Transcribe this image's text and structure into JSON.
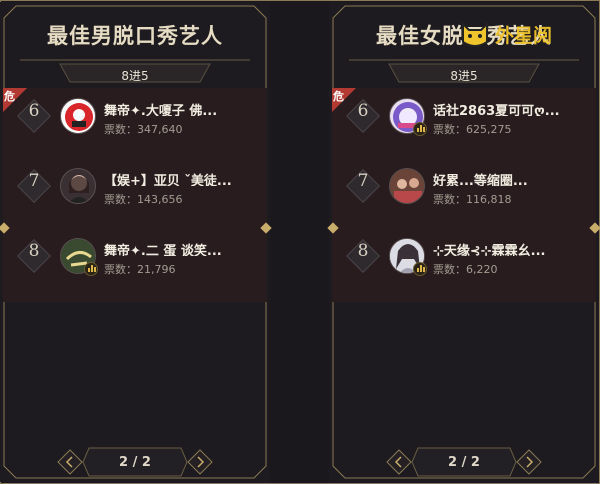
{
  "panels": [
    {
      "title": "最佳男脱口秀艺人",
      "round_label": "8进5",
      "danger_label": "危",
      "page_indicator": "2 / 2",
      "entries": [
        {
          "rank": "6",
          "name": "舞帝✦.大嗄子 佛...",
          "votes": "票数：347,640",
          "avatar_color": "#d8262a",
          "avatar_icon": "red-character-avatar"
        },
        {
          "rank": "7",
          "name": "【娱+】亚贝 ˇ美徒...",
          "votes": "票数：143,656",
          "avatar_color": "#7a6a68",
          "avatar_icon": "girl-photo-avatar"
        },
        {
          "rank": "8",
          "name": "舞帝✦.二 蛋 谈笑...",
          "votes": "票数：21,796",
          "avatar_color": "#3a4a30",
          "avatar_icon": "calligraphy-avatar"
        }
      ]
    },
    {
      "title": "最佳女脱口秀艺人",
      "round_label": "8进5",
      "danger_label": "危",
      "page_indicator": "2 / 2",
      "entries": [
        {
          "rank": "6",
          "name": "话社2863夏可可ღ...",
          "votes": "票数：625,275",
          "avatar_color": "#7a5ac8",
          "avatar_icon": "purple-badge-avatar"
        },
        {
          "rank": "7",
          "name": "好累...等缩圈...",
          "votes": "票数：116,818",
          "avatar_color": "#8a5a48",
          "avatar_icon": "group-photo-avatar"
        },
        {
          "rank": "8",
          "name": "⊹天缘⊰⊹霖霖幺...",
          "votes": "票数：6,220",
          "avatar_color": "#c8c8d0",
          "avatar_icon": "girl-portrait-avatar"
        }
      ]
    }
  ],
  "watermark": {
    "text": "外星阅",
    "icon": "cat-face-logo-icon",
    "color": "#f0c42c"
  },
  "colors": {
    "gold": "#c9ad6a",
    "danger": "#b33a32",
    "list_bg": "#281c1e",
    "bg": "#1a181c"
  }
}
